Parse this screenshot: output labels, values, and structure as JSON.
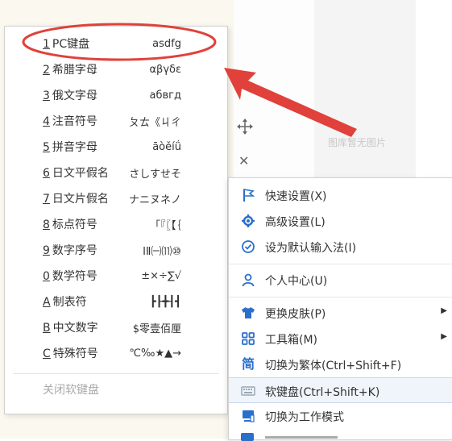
{
  "background": {
    "no_image_text": "图库暂无图片"
  },
  "keyboard_menu": {
    "items": [
      {
        "key": "1",
        "label": "PC键盘",
        "sample": "asdfg"
      },
      {
        "key": "2",
        "label": "希腊字母",
        "sample": "αβγδε"
      },
      {
        "key": "3",
        "label": "俄文字母",
        "sample": "абвгд"
      },
      {
        "key": "4",
        "label": "注音符号",
        "sample": "ㄆㄊ《ㄐㄔ"
      },
      {
        "key": "5",
        "label": "拼音字母",
        "sample": "āòěíǘ"
      },
      {
        "key": "6",
        "label": "日文平假名",
        "sample": "さしすせそ"
      },
      {
        "key": "7",
        "label": "日文片假名",
        "sample": "ナニヌネノ"
      },
      {
        "key": "8",
        "label": "标点符号",
        "sample": "「『〖【｛"
      },
      {
        "key": "9",
        "label": "数字序号",
        "sample": "ⅠⅡ㈠⑾⑩"
      },
      {
        "key": "0",
        "label": "数学符号",
        "sample": "±×÷∑√"
      },
      {
        "key": "A",
        "label": "制表符",
        "sample": "┣┠╋┨┫"
      },
      {
        "key": "B",
        "label": "中文数字",
        "sample": "$零壹佰厘"
      },
      {
        "key": "C",
        "label": "特殊符号",
        "sample": "℃‰★▲→"
      }
    ],
    "close_label": "关闭软键盘"
  },
  "context_menu": {
    "items": [
      {
        "icon": "flag-icon",
        "label": "快速设置(X)"
      },
      {
        "icon": "gear-icon",
        "label": "高级设置(L)"
      },
      {
        "icon": "check-circle-icon",
        "label": "设为默认输入法(I)"
      },
      {
        "icon": "person-icon",
        "label": "个人中心(U)"
      },
      {
        "icon": "shirt-icon",
        "label": "更换皮肤(P)"
      },
      {
        "icon": "grid-icon",
        "label": "工具箱(M)"
      },
      {
        "icon": "traditional-char-icon",
        "label": "切换为繁体(Ctrl+Shift+F)",
        "icon_char": "简"
      },
      {
        "icon": "keyboard-icon",
        "label": "软键盘(Ctrl+Shift+K)"
      },
      {
        "icon": "work-mode-icon",
        "label": "切换为工作模式"
      }
    ]
  },
  "colors": {
    "accent": "#2a6fcc",
    "annotation": "#e0413a"
  }
}
